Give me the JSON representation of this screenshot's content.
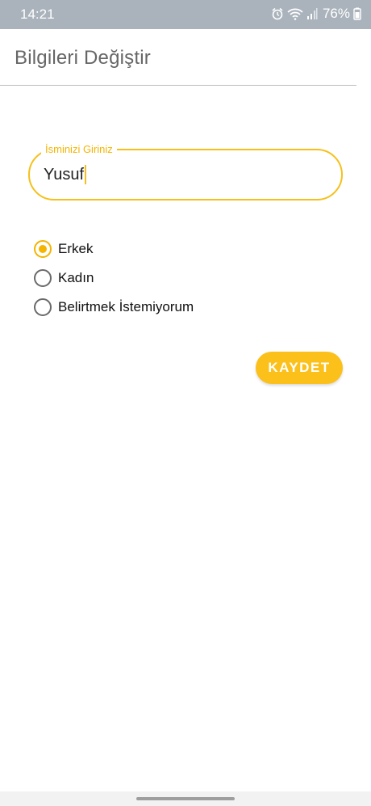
{
  "status_bar": {
    "time": "14:21",
    "battery": "76%",
    "icons": [
      "alarm-icon",
      "wifi-icon",
      "signal-icon",
      "battery-icon"
    ]
  },
  "app_bar": {
    "title": "Bilgileri Değiştir"
  },
  "name_field": {
    "label": "İsminizi Giriniz",
    "value": "Yusuf"
  },
  "gender_options": [
    {
      "label": "Erkek",
      "checked": true
    },
    {
      "label": "Kadın",
      "checked": false
    },
    {
      "label": "Belirtmek İstemiyorum",
      "checked": false
    }
  ],
  "save_button": {
    "label": "KAYDET"
  },
  "colors": {
    "accent": "#F5C01B",
    "status_bar": "#AAB3BC",
    "title_text": "#666666"
  }
}
